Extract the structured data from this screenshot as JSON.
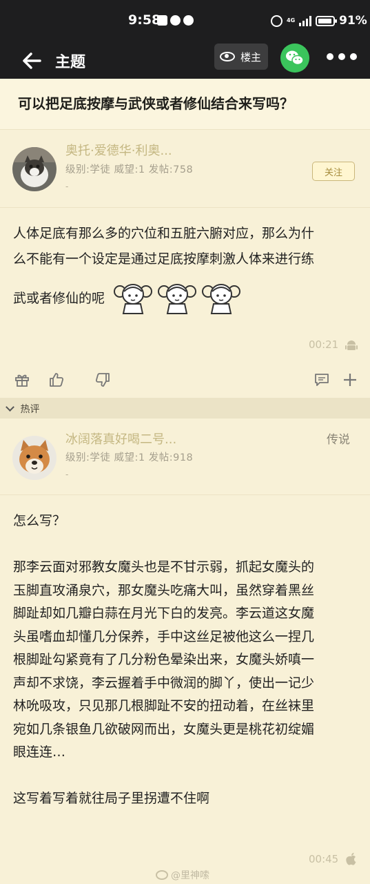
{
  "status_bar": {
    "time": "9:58",
    "battery": "91%",
    "network": "4G"
  },
  "nav": {
    "title": "主题",
    "op_only_label": "楼主"
  },
  "topic": {
    "title": "可以把足底按摩与武侠或者修仙结合来写吗？"
  },
  "post": {
    "author": "奥托·爱德华·利奥...",
    "meta": "级别:学徒  威望:1  发帖:758",
    "dash": "-",
    "follow_label": "关注",
    "lines": [
      "人体足底有那么多的穴位和五脏六腑对应，那么为什",
      "么不能有一个设定是通过足底按摩刺激人体来进行练",
      "武或者修仙的呢"
    ],
    "time": "00:21",
    "platform_icon": "android-icon"
  },
  "hot_section": {
    "label": "热评"
  },
  "reply": {
    "author": "冰阔落真好喝二号...",
    "meta": "级别:学徒  威望:1  发帖:918",
    "dash": "-",
    "tag": "传说",
    "lines": [
      "怎么写？",
      "",
      "那李云面对邪教女魔头也是不甘示弱，抓起女魔头的",
      "玉脚直攻涌泉穴，那女魔头吃痛大叫，虽然穿着黑丝",
      "脚趾却如几瓣白蒜在月光下白的发亮。李云道这女魔",
      "头虽嗜血却懂几分保养，手中这丝足被他这么一捏几",
      "根脚趾勾紧竟有了几分粉色晕染出来，女魔头娇嗔一",
      "声却不求饶，李云握着手中微润的脚丫，使出一记少",
      "林吮吸攻，只见那几根脚趾不安的扭动着，在丝袜里",
      "宛如几条银鱼几欲破网而出，女魔头更是桃花初绽媚",
      "眼连连…",
      "",
      "这写着写着就往局子里拐遭不住啊"
    ],
    "time": "00:45",
    "platform_icon": "apple-icon"
  },
  "watermark": "@里神嗦"
}
